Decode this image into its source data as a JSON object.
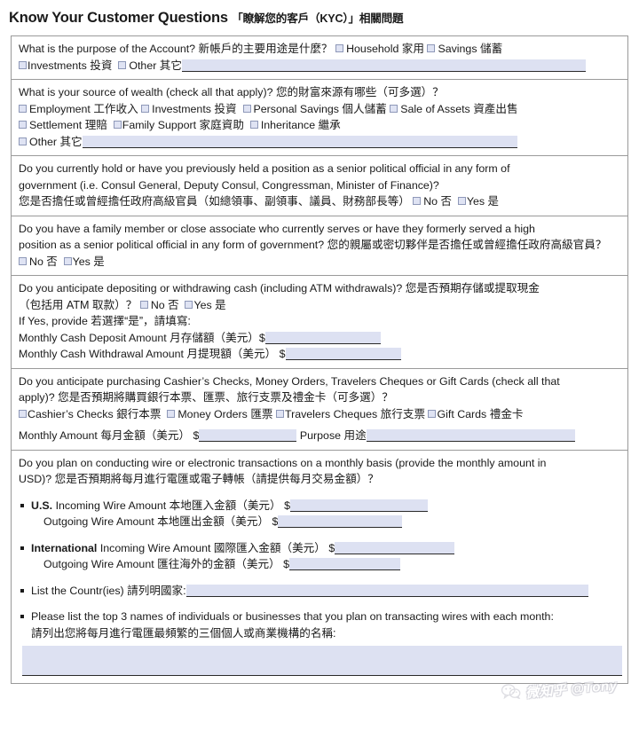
{
  "title": {
    "en": "Know Your Customer Questions",
    "cn": "「瞭解您的客戶（KYC）」相關問題"
  },
  "colors": {
    "field_fill": "#dde1f2",
    "checkbox_fill": "#dfe3f3",
    "checkbox_border": "#8e98b8",
    "table_border": "#9a9a9a",
    "text": "#1a1a1a"
  },
  "sections": {
    "purpose": {
      "question_en": "What is the purpose of the Account?",
      "question_cn": "新帳戶的主要用途是什麼？",
      "options": [
        {
          "en": "Household",
          "cn": "家用"
        },
        {
          "en": "Savings",
          "cn": "儲蓄"
        },
        {
          "en": "Investments",
          "cn": "投資"
        },
        {
          "en": "Other",
          "cn": "其它"
        }
      ],
      "other_value": ""
    },
    "wealth": {
      "question_en": "What is your source of wealth (check all that apply)?",
      "question_cn": "您的財富來源有哪些（可多選）？",
      "options": [
        {
          "en": "Employment",
          "cn": "工作收入"
        },
        {
          "en": "Investments",
          "cn": "投資"
        },
        {
          "en": "Personal Savings",
          "cn": "個人儲蓄"
        },
        {
          "en": "Sale of Assets",
          "cn": "資產出售"
        },
        {
          "en": "Settlement",
          "cn": "理賠"
        },
        {
          "en": "Family Support",
          "cn": "家庭資助"
        },
        {
          "en": "Inheritance",
          "cn": "繼承"
        },
        {
          "en": "Other",
          "cn": "其它"
        }
      ],
      "other_value": ""
    },
    "pep_self": {
      "question_en_line1": "Do you currently hold or have you previously held a position as a senior political official in any form of",
      "question_en_line2": "government (i.e.  Consul General, Deputy Consul, Congressman, Minister of Finance)?",
      "question_cn": "您是否擔任或曾經擔任政府高級官員（如總領事、副領事、議員、財務部長等）",
      "no_label": "No 否",
      "yes_label": "Yes 是"
    },
    "pep_family": {
      "question_en_line1": "Do you have a family member or close associate who currently serves or have they formerly served a high",
      "question_en_line2": "position as a senior political official in any form of government?",
      "question_cn": "您的親屬或密切夥伴是否擔任或曾經擔任政府高級官員？",
      "no_label": "No 否",
      "yes_label": "Yes 是"
    },
    "cash": {
      "question_en": "Do you anticipate depositing or withdrawing cash (including ATM withdrawals)?",
      "question_cn_1": "您是否預期存儲或提取現金",
      "question_cn_2": "（包括用 ATM 取款）？",
      "no_label": "No 否",
      "yes_label": "Yes 是",
      "if_yes_en": "If Yes, provide",
      "if_yes_cn": "若選擇“是”，請填寫:",
      "deposit_label_en": "Monthly Cash Deposit Amount",
      "deposit_label_cn": "月存儲額（美元）",
      "deposit_currency": "$",
      "deposit_value": "",
      "withdrawal_label_en": "Monthly Cash Withdrawal Amount",
      "withdrawal_label_cn": "月提現額（美元）",
      "withdrawal_currency": "$",
      "withdrawal_value": ""
    },
    "instruments": {
      "question_en_line1": "Do you anticipate purchasing Cashier’s Checks, Money Orders, Travelers Cheques or Gift Cards (check all that",
      "question_en_line2": "apply)?",
      "question_cn": "您是否預期將購買銀行本票、匯票、旅行支票及禮金卡（可多選）？",
      "options": [
        {
          "en": "Cashier’s Checks",
          "cn": "銀行本票"
        },
        {
          "en": "Money Orders",
          "cn": "匯票"
        },
        {
          "en": "Travelers Cheques",
          "cn": "旅行支票"
        },
        {
          "en": "Gift Cards",
          "cn": "禮金卡"
        }
      ],
      "monthly_label_en": "Monthly Amount",
      "monthly_label_cn": "每月金額（美元）",
      "monthly_currency": "$",
      "monthly_value": "",
      "purpose_label_en": "Purpose",
      "purpose_label_cn": "用途",
      "purpose_value": ""
    },
    "wires": {
      "question_en_line1": "Do you plan on conducting wire or electronic transactions on a monthly basis (provide the monthly amount in",
      "question_en_line2": "USD)?",
      "question_cn": "您是否預期將每月進行電匯或電子轉帳（請提供每月交易金額）？",
      "us": {
        "strong": "U.S.",
        "incoming_en": "Incoming Wire Amount",
        "incoming_cn": "本地匯入金額（美元）",
        "incoming_currency": "$",
        "incoming_value": "",
        "outgoing_en": "Outgoing Wire Amount",
        "outgoing_cn": "本地匯出金額（美元）",
        "outgoing_currency": "$",
        "outgoing_value": ""
      },
      "international": {
        "strong": "International",
        "incoming_en": "Incoming Wire Amount",
        "incoming_cn": "國際匯入金額（美元）",
        "incoming_currency": "$",
        "incoming_value": "",
        "outgoing_en": "Outgoing Wire Amount",
        "outgoing_cn": "匯往海外的金額（美元）",
        "outgoing_currency": "$",
        "outgoing_value": ""
      },
      "countries_en": "List the Countr(ies)",
      "countries_cn": "請列明國家:",
      "countries_value": "",
      "top3_en": "Please list the top 3 names of individuals or businesses that you plan on transacting wires with each month:",
      "top3_cn": "請列出您將每月進行電匯最頻繁的三個個人或商業機構的名稱:",
      "top3_value": ""
    }
  },
  "watermark": {
    "text": "微知乎 @Tony",
    "icon": "wechat-icon"
  }
}
